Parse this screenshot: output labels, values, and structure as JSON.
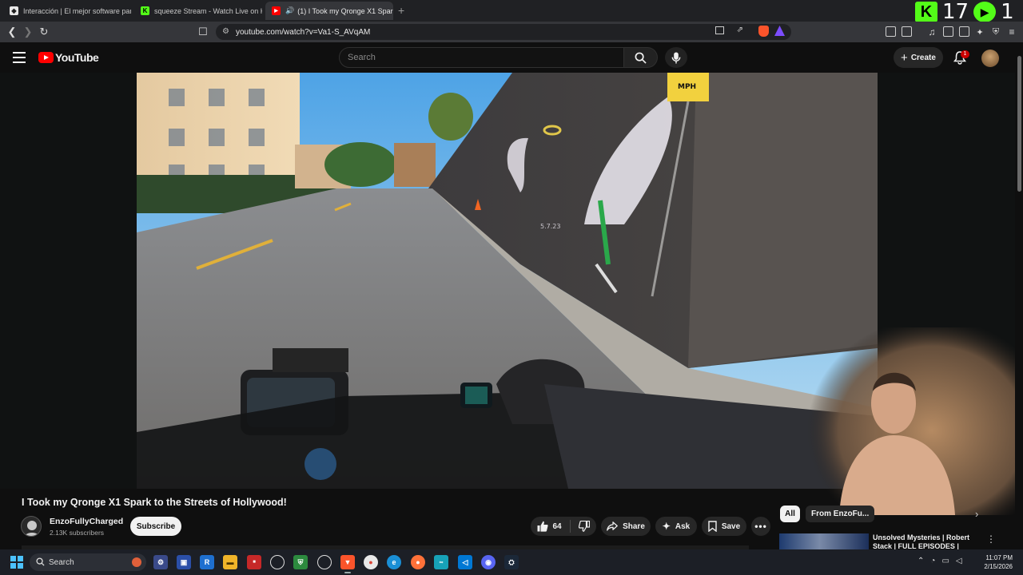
{
  "browser": {
    "tabs": [
      {
        "title": "Interacción | El mejor software para p",
        "favicon_color": "#e8e8e8",
        "active": false
      },
      {
        "title": "squeeze Stream - Watch Live on Kick",
        "favicon_color": "#53fc18",
        "active": false
      },
      {
        "title": "(1) I Took my Qronge X1 Spar",
        "favicon_color": "#ff0000",
        "active": true
      }
    ],
    "url": "youtube.com/watch?v=Va1-S_AVqAM",
    "overlay_counter": {
      "left_number": "17",
      "right_number": "1"
    }
  },
  "youtube": {
    "logo_text": "YouTube",
    "search_placeholder": "Search",
    "create_label": "Create",
    "notification_count": "1"
  },
  "video": {
    "title": "I Took my Qronge X1 Spark to the Streets of Hollywood!",
    "overlay_texts": {
      "mural_date": "5.7.23",
      "sign_text": "MPH"
    },
    "channel": {
      "name": "EnzoFullyCharged",
      "subscribers": "2.13K subscribers",
      "subscribe_label": "Subscribe"
    },
    "actions": {
      "like_count": "64",
      "share_label": "Share",
      "ask_label": "Ask",
      "save_label": "Save"
    }
  },
  "sidebar": {
    "chips": [
      "All",
      "From EnzoFu..."
    ],
    "recommendation": {
      "title": "Unsolved Mysteries | Robert Stack | FULL EPISODES |"
    }
  },
  "taskbar": {
    "search_label": "Search",
    "clock_time": "11:07 PM",
    "clock_date": "2/15/2026"
  },
  "colors": {
    "accent": "#ff0000",
    "kick_green": "#53fc18",
    "background": "#0f0f0f"
  }
}
